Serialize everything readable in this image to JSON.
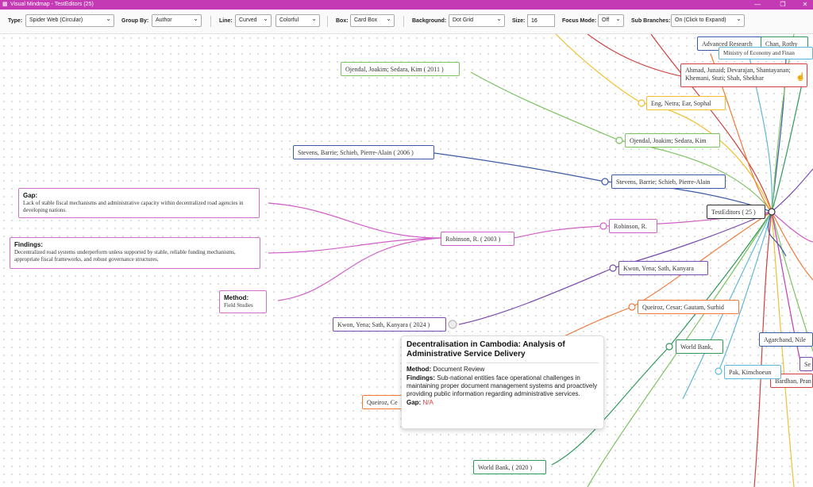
{
  "window": {
    "title": "Visual Mindmap - TestEditors (25)",
    "app_icon": "mindmap-icon"
  },
  "toolbar": {
    "type_label": "Type:",
    "type_value": "Spider Web (Circular)",
    "group_label": "Group By:",
    "group_value": "Author",
    "line_label": "Line:",
    "line_style": "Curved",
    "line_color": "Colorful",
    "box_label": "Box:",
    "box_value": "Card Box",
    "bg_label": "Background:",
    "bg_value": "Dot Grid",
    "size_label": "Size:",
    "size_value": "16",
    "focus_label": "Focus Mode:",
    "focus_value": "Off",
    "sub_label": "Sub Branches:",
    "sub_value": "On (Click to Expand)"
  },
  "colors": {
    "accent": "#c43ab4",
    "green": "#7cc35f",
    "blue": "#3b5aa8",
    "pink": "#d060c8",
    "purple": "#7a4ab0",
    "orange": "#f07a3a",
    "yellow": "#f0c030",
    "red": "#d04040",
    "darkgreen": "#2f9a5a"
  },
  "center": {
    "label": "TestEditors ( 25 )"
  },
  "nodes": {
    "advanced": "Advanced Research",
    "chan": "Chan, Rothy",
    "ministry": "Ministry of Economy and Finan",
    "ahmad": "Ahmad, Junaid; Devarajan, Shantayanan; Khemani, Stuti; Shah, Shekhar",
    "eng": "Eng, Netra; Ear, Sophal",
    "ojendal_2011": "Ojendal, Joakim; Sedara, Kim ( 2011 )",
    "ojendal": "Ojendal, Joakim; Sedara, Kim",
    "stevens_2006": "Stevens, Barrie; Schieb, Pierre-Alain ( 2006 )",
    "stevens": "Stevens, Barrie; Schieb, Pierre-Alain",
    "robinson_2003": "Robinson, R. ( 2003 )",
    "robinson": "Robinson, R.",
    "kwon": "Kwon, Yena; Sath, Kanyara",
    "kwon_2024": "Kwon, Yena; Sath, Kanyara ( 2024 )",
    "queiroz": "Queiroz, Cesar; Gautam, Surhid",
    "queiroz_left": "Queiroz, Ce",
    "worldbank": "World Bank,",
    "worldbank_2020": "World Bank, ( 2020 )",
    "agarchand": "Agarchand, Nile",
    "se": "Se",
    "pak": "Pak, Kimchoeun",
    "bardhan": "Bardhan, Pran"
  },
  "cards": {
    "gap": {
      "heading": "Gap:",
      "text": "Lack of stable fiscal mechanisms and administrative capacity within decentralized road agencies in developing nations."
    },
    "findings": {
      "heading": "Findings:",
      "text": "Decentralized road systems underperform unless supported by stable, reliable funding mechanisms, appropriate fiscal frameworks, and robust governance structures."
    },
    "method": {
      "heading": "Method:",
      "text": "Field Studies"
    }
  },
  "tooltip": {
    "title": "Decentralisation in Cambodia: Analysis of Administrative Service Delivery",
    "method_label": "Method:",
    "method_value": "Document Review",
    "findings_label": "Findings:",
    "findings_value": "Sub-national entities face operational challenges in maintaining proper document management systems and proactively providing public information regarding administrative services.",
    "gap_label": "Gap:",
    "gap_value": "N/A"
  }
}
